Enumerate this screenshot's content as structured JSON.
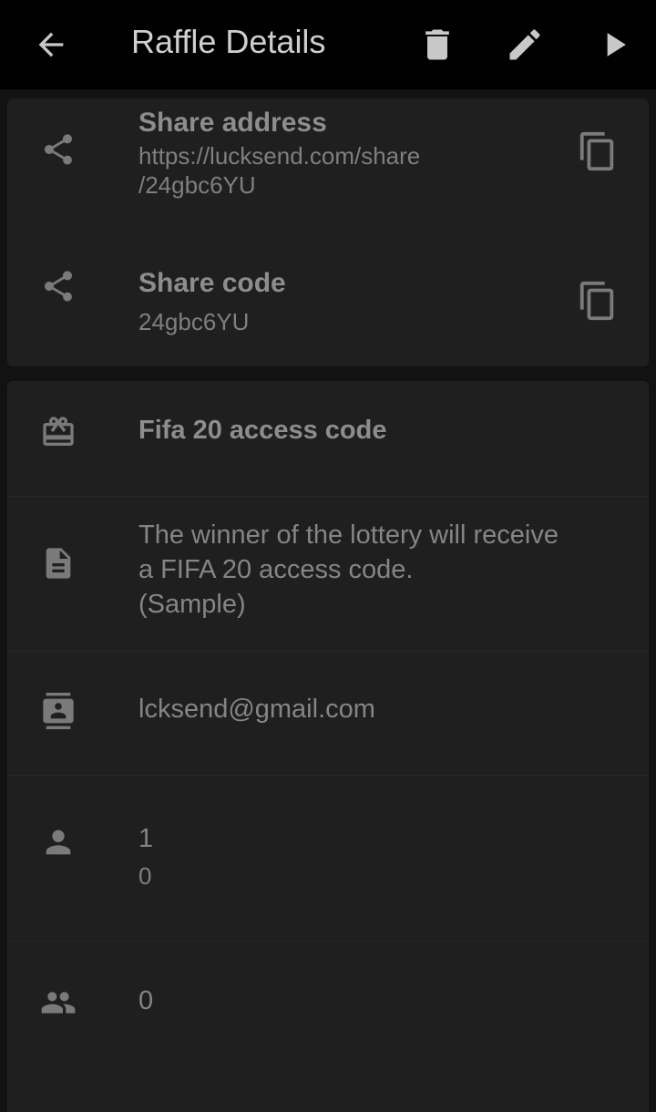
{
  "appbar": {
    "title": "Raffle Details",
    "icons": [
      "arrow-back-icon",
      "trash-icon",
      "pencil-icon",
      "play-icon"
    ]
  },
  "share": {
    "address_label": "Share address",
    "address_line1": "https://lucksend.com/share",
    "address_line2": "/24gbc6YU",
    "code_label": "Share code",
    "code_value": "24gbc6YU"
  },
  "details": {
    "title": "Fifa 20 access code",
    "description_line1": "The winner of the lottery will receive",
    "description_line2": "a FIFA 20 access code.",
    "description_line3": "(Sample)",
    "contact": "lcksend@gmail.com",
    "winners": "1",
    "winners_sub": "0",
    "participants": "0"
  }
}
